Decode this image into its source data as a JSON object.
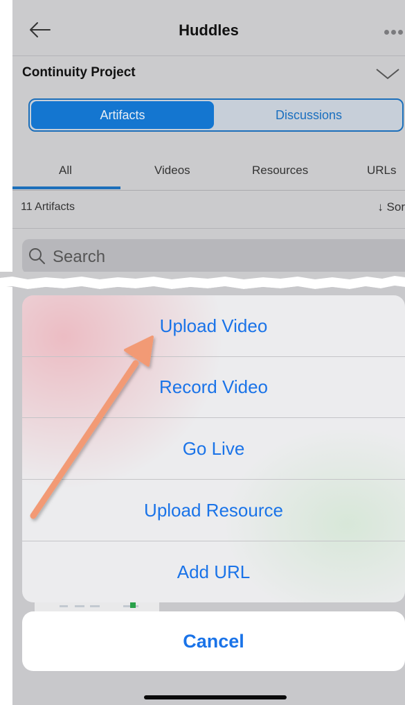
{
  "header": {
    "title": "Huddles"
  },
  "project": {
    "name": "Continuity Project"
  },
  "segments": {
    "artifacts": "Artifacts",
    "discussions": "Discussions"
  },
  "tabs": {
    "all": "All",
    "videos": "Videos",
    "resources": "Resources",
    "urls": "URLs"
  },
  "list": {
    "count": "11 Artifacts",
    "sort_label": "↓  Sor"
  },
  "search": {
    "placeholder": "Search"
  },
  "action_sheet": {
    "items": [
      "Upload Video",
      "Record Video",
      "Go Live",
      "Upload Resource",
      "Add URL"
    ],
    "cancel": "Cancel"
  },
  "colors": {
    "accent": "#1a73e8",
    "segment_active": "#1476d0",
    "annotation_arrow": "#f29a74"
  },
  "icons": [
    "back-arrow-icon",
    "more-dots-icon",
    "chevron-down-icon",
    "search-icon"
  ]
}
